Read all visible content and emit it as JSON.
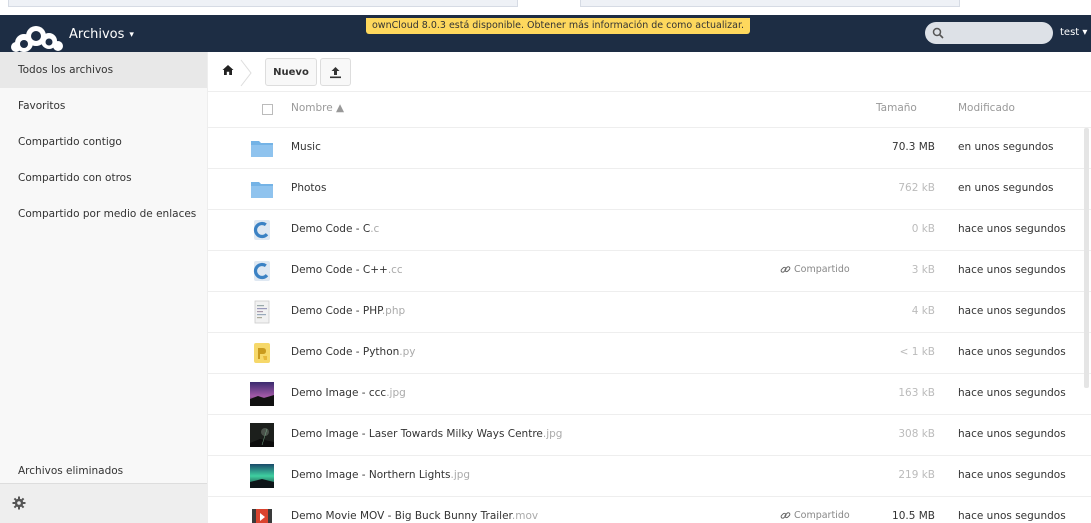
{
  "header": {
    "app_name": "Archivos",
    "app_caret": "▾",
    "update_notice": "ownCloud 8.0.3 está disponible. Obtener más información de como actualizar.",
    "search_placeholder": "",
    "user": "test ▾"
  },
  "colors": {
    "header_bg": "#1d2d44",
    "notice_bg": "#fed85d",
    "folder_blue": "#74b3e6"
  },
  "sidebar": {
    "items": [
      {
        "label": "Todos los archivos",
        "active": true
      },
      {
        "label": "Favoritos"
      },
      {
        "label": "Compartido contigo"
      },
      {
        "label": "Compartido con otros"
      },
      {
        "label": "Compartido por medio de enlaces"
      }
    ],
    "deleted_files": "Archivos eliminados",
    "settings_icon": "gear-icon"
  },
  "controls": {
    "home_icon": "home-icon",
    "new_label": "Nuevo",
    "upload_icon": "upload-icon"
  },
  "list": {
    "columns": {
      "name": "Nombre ▲",
      "size": "Tamaño",
      "modified": "Modificado"
    },
    "rows": [
      {
        "name": "Music",
        "ext": "",
        "share": "",
        "size": "70.3 MB",
        "modified": "en unos segundos",
        "icon": "folder-icon"
      },
      {
        "name": "Photos",
        "ext": "",
        "share": "",
        "size": "762 kB",
        "modified": "en unos segundos",
        "icon": "folder-icon"
      },
      {
        "name": "Demo Code - C",
        "ext": ".c",
        "share": "",
        "size": "0 kB",
        "modified": "hace unos segundos",
        "icon": "c-file-icon"
      },
      {
        "name": "Demo Code - C++",
        "ext": ".cc",
        "share": "Compartido",
        "size": "3 kB",
        "modified": "hace unos segundos",
        "icon": "cpp-file-icon"
      },
      {
        "name": "Demo Code - PHP",
        "ext": ".php",
        "share": "",
        "size": "4 kB",
        "modified": "hace unos segundos",
        "icon": "php-file-icon"
      },
      {
        "name": "Demo Code - Python",
        "ext": ".py",
        "share": "",
        "size": "< 1 kB",
        "modified": "hace unos segundos",
        "icon": "python-file-icon"
      },
      {
        "name": "Demo Image - ccc",
        "ext": ".jpg",
        "share": "",
        "size": "163 kB",
        "modified": "hace unos segundos",
        "icon": "image-thumbnail"
      },
      {
        "name": "Demo Image - Laser Towards Milky Ways Centre",
        "ext": ".jpg",
        "share": "",
        "size": "308 kB",
        "modified": "hace unos segundos",
        "icon": "image-thumbnail"
      },
      {
        "name": "Demo Image - Northern Lights",
        "ext": ".jpg",
        "share": "",
        "size": "219 kB",
        "modified": "hace unos segundos",
        "icon": "image-thumbnail"
      },
      {
        "name": "Demo Movie MOV - Big Buck Bunny Trailer",
        "ext": ".mov",
        "share": "Compartido",
        "size": "10.5 MB",
        "modified": "hace unos segundos",
        "icon": "video-file-icon"
      }
    ]
  }
}
